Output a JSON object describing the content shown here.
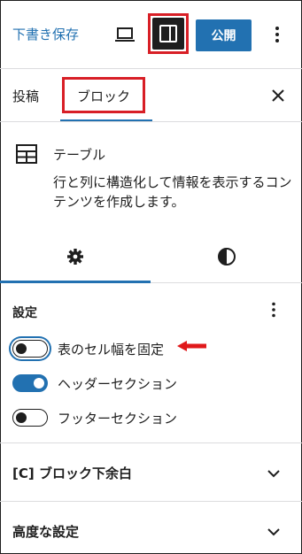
{
  "toolbar": {
    "save_draft_label": "下書き保存",
    "preview_icon": "laptop-icon",
    "settings_icon": "sidebar-toggle-icon",
    "publish_label": "公開",
    "more_icon": "vertical-ellipsis-icon",
    "highlight_color": "#d81f26",
    "accent_color": "#2271b1"
  },
  "tabs": {
    "post_label": "投稿",
    "block_label": "ブロック",
    "active": "block",
    "close_icon": "close-icon"
  },
  "block_card": {
    "icon": "table-icon",
    "title": "テーブル",
    "description": "行と列に構造化して情報を表示するコンテンツを作成します。"
  },
  "subtabs": {
    "settings_icon": "gear-icon",
    "styles_icon": "half-circle-icon",
    "active": "settings"
  },
  "settings_panel": {
    "title": "設定",
    "more_icon": "vertical-ellipsis-icon",
    "toggles": [
      {
        "label": "表のセル幅を固定",
        "checked": false,
        "focused": true
      },
      {
        "label": "ヘッダーセクション",
        "checked": true,
        "focused": false
      },
      {
        "label": "フッターセクション",
        "checked": false,
        "focused": false
      }
    ],
    "annotation": "red-arrow-icon"
  },
  "sections": [
    {
      "title": "[C] ブロック下余白",
      "icon": "chevron-down-icon"
    },
    {
      "title": "高度な設定",
      "icon": "chevron-down-icon"
    }
  ]
}
